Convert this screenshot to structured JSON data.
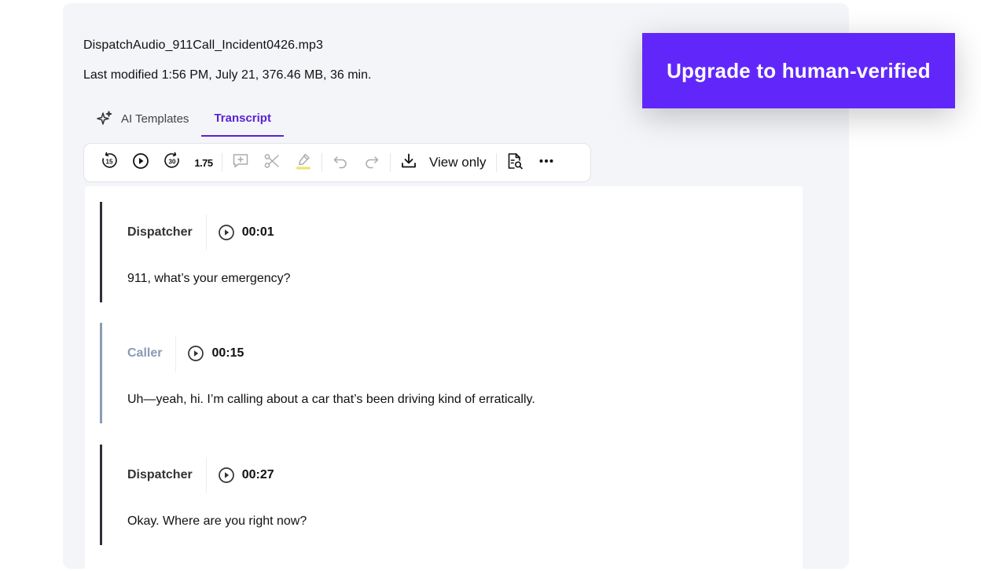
{
  "file": {
    "name": "DispatchAudio_911Call_Incident0426.mp3",
    "meta": "Last modified 1:56 PM, July 21, 376.46 MB, 36 min."
  },
  "tabs": [
    {
      "label": "AI Templates",
      "icon": "sparkles-icon",
      "active": false
    },
    {
      "label": "Transcript",
      "active": true
    }
  ],
  "toolbar": {
    "rewind_icon": "rewind-15-icon",
    "play_icon": "play-icon",
    "forward_icon": "forward-30-icon",
    "speed": "1.75",
    "add_comment_icon": "add-comment-icon",
    "cut_icon": "scissors-icon",
    "highlight_icon": "highlighter-icon",
    "undo_icon": "undo-icon",
    "redo_icon": "redo-icon",
    "download_icon": "download-icon",
    "view_mode": "View only",
    "search_doc_icon": "document-search-icon",
    "more_icon": "more-icon"
  },
  "segments": [
    {
      "speaker": "Dispatcher",
      "timestamp": "00:01",
      "text": "911, what’s your emergency?",
      "bar_color": "#2e3138"
    },
    {
      "speaker": "Caller",
      "timestamp": "00:15",
      "text": "Uh—yeah, hi. I’m calling about a car that’s been driving kind of erratically.",
      "bar_color": "#8a9bb5"
    },
    {
      "speaker": "Dispatcher",
      "timestamp": "00:27",
      "text": "Okay. Where are you right now?",
      "bar_color": "#2e3138"
    }
  ],
  "upgrade_button": "Upgrade to human-verified",
  "colors": {
    "accent": "#5b21d6",
    "upgrade_bg": "#6127fa",
    "highlight": "#e8e66a"
  }
}
